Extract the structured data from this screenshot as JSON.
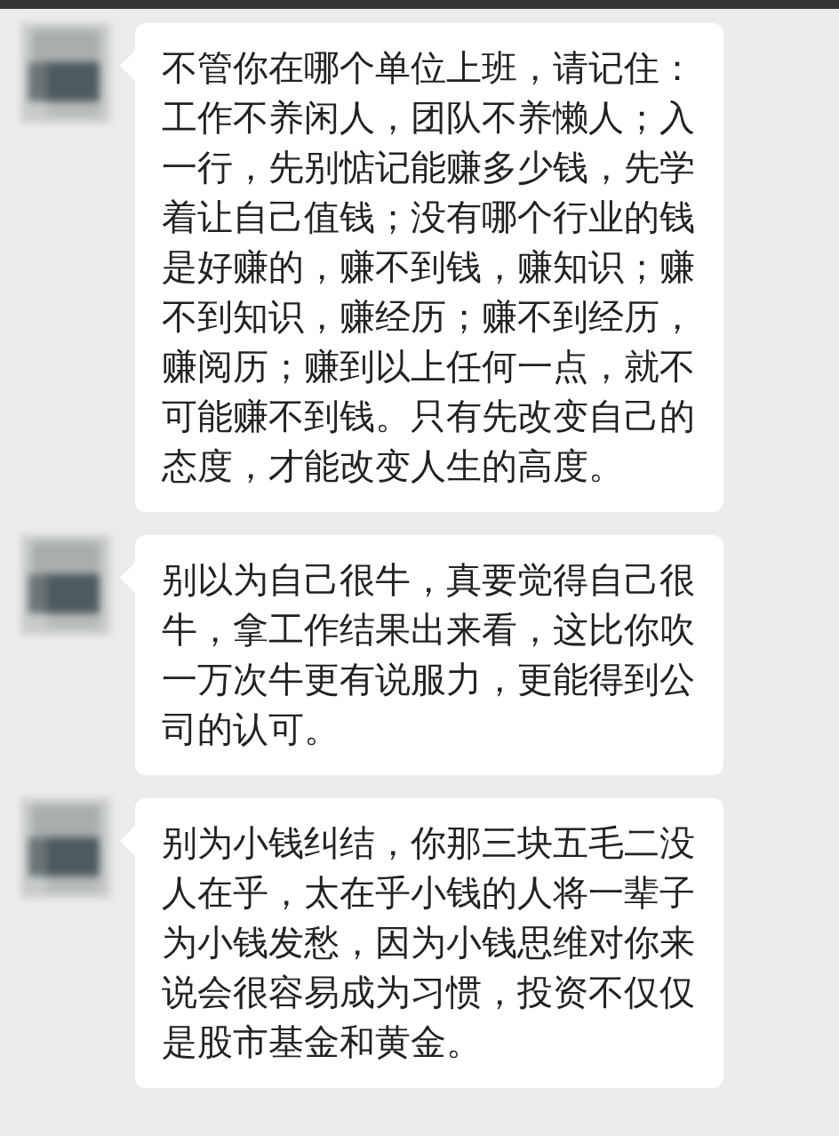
{
  "messages": [
    {
      "text": "不管你在哪个单位上班，请记住：工作不养闲人，团队不养懒人；入一行，先别惦记能赚多少钱，先学着让自己值钱；没有哪个行业的钱是好赚的，赚不到钱，赚知识；赚不到知识，赚经历；赚不到经历，赚阅历；赚到以上任何一点，就不可能赚不到钱。只有先改变自己的态度，才能改变人生的高度。"
    },
    {
      "text": "别以为自己很牛，真要觉得自己很牛，拿工作结果出来看，这比你吹一万次牛更有说服力，更能得到公司的认可。"
    },
    {
      "text": "别为小钱纠结，你那三块五毛二没人在乎，太在乎小钱的人将一辈子为小钱发愁，因为小钱思维对你来说会很容易成为习惯，投资不仅仅是股市基金和黄金。"
    }
  ]
}
